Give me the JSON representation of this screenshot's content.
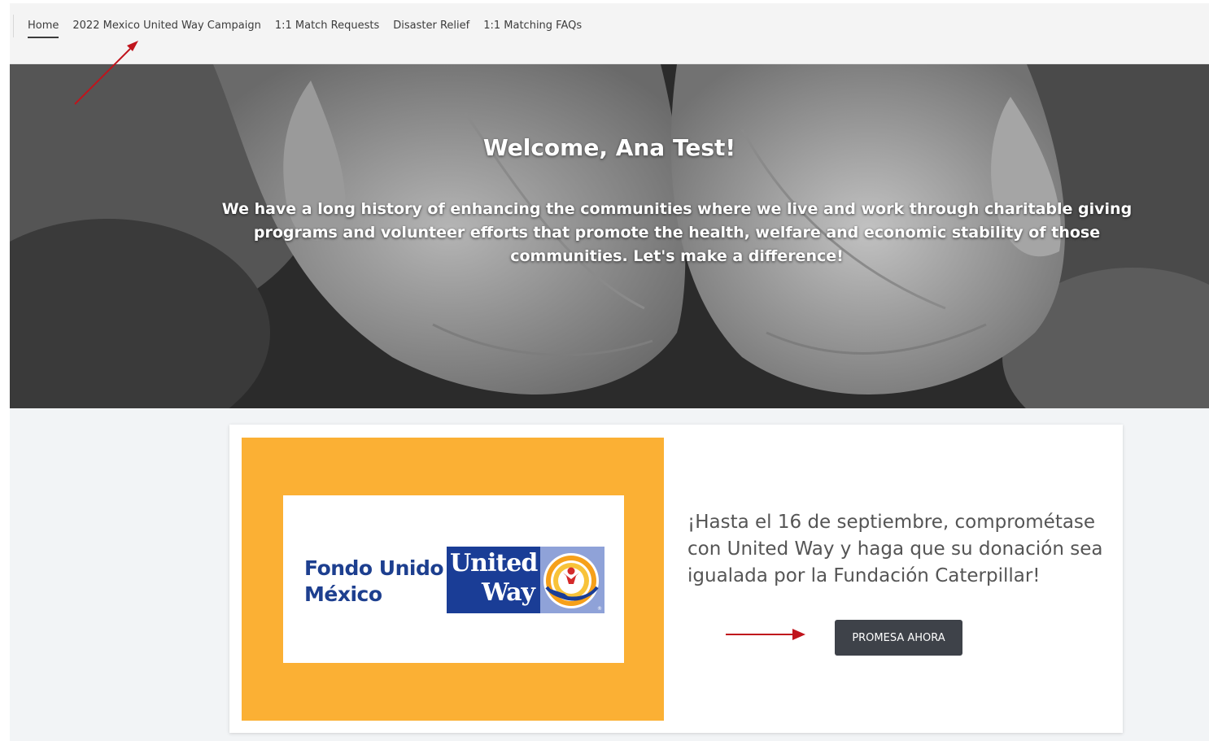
{
  "nav": {
    "items": [
      {
        "label": "Home",
        "active": true
      },
      {
        "label": "2022 Mexico United Way Campaign",
        "active": false
      },
      {
        "label": "1:1 Match Requests",
        "active": false
      },
      {
        "label": "Disaster Relief",
        "active": false
      },
      {
        "label": "1:1 Matching FAQs",
        "active": false
      }
    ]
  },
  "hero": {
    "title": "Welcome, Ana Test!",
    "body": "We have a long history of enhancing the communities where we live and work through charitable giving programs and volunteer efforts that promote the health, welfare and economic stability of those communities. Let's make a difference!"
  },
  "campaign": {
    "logo": {
      "fondo_line1": "Fondo Unido",
      "fondo_line2": "México",
      "uw_line1": "United",
      "uw_line2": "Way"
    },
    "message": "¡Hasta el 16 de septiembre, comprométase con United Way y haga que su donación sea igualada por la Fundación Caterpillar!",
    "button_label": "PROMESA AHORA"
  },
  "colors": {
    "banner_yellow": "#fbb034",
    "uw_blue": "#1a3d96",
    "button_dark": "#3e4249",
    "annotation_red": "#c0141c"
  }
}
